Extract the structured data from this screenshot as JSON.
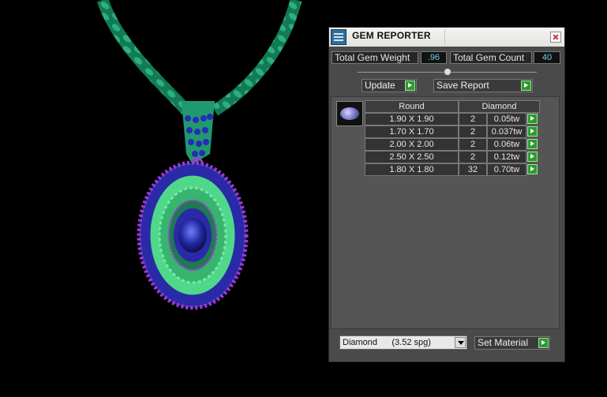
{
  "window": {
    "title": "GEM REPORTER"
  },
  "stats": {
    "total_weight_label": "Total Gem Weight",
    "total_weight_value": ".96",
    "total_count_label": "Total Gem Count",
    "total_count_value": "40"
  },
  "slider": {
    "level_fraction": 0.5
  },
  "buttons": {
    "update": "Update",
    "save_report": "Save Report",
    "set_material": "Set Material"
  },
  "table": {
    "shape_header": "Round",
    "material_header": "Diamond",
    "rows": [
      {
        "size": "1.90 X 1.90",
        "count": "2",
        "weight": "0.05tw"
      },
      {
        "size": "1.70 X 1.70",
        "count": "2",
        "weight": "0.037tw"
      },
      {
        "size": "2.00 X 2.00",
        "count": "2",
        "weight": "0.06tw"
      },
      {
        "size": "2.50 X 2.50",
        "count": "2",
        "weight": "0.12tw"
      },
      {
        "size": "1.80 X 1.80",
        "count": "32",
        "weight": "0.70tw"
      }
    ]
  },
  "material_select": {
    "value": "Diamond      (3.52 spg)"
  },
  "colors": {
    "chain": "#1f9a6e",
    "stone_blue": "#2a2aa8",
    "pave_green": "#4fd88a",
    "accent_purple": "#a03ad0"
  }
}
